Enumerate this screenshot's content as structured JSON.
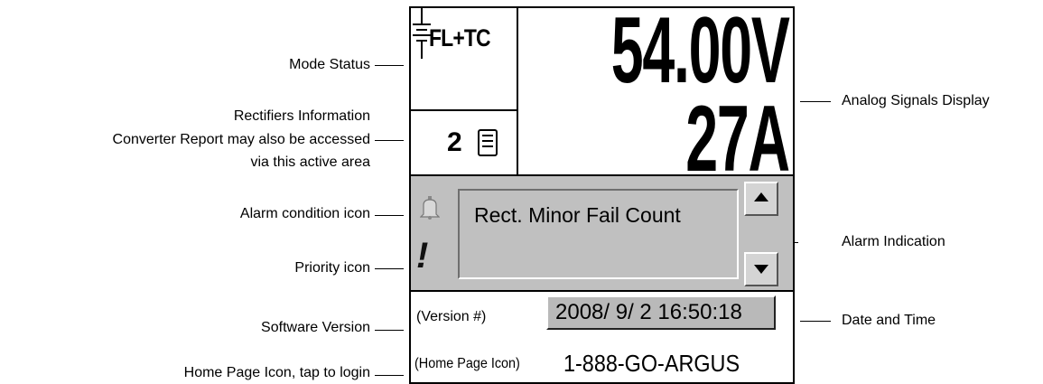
{
  "labels": {
    "mode_status": "Mode Status",
    "rectifiers_1": "Rectifiers Information",
    "rectifiers_2": "Converter Report may also be accessed",
    "rectifiers_3": "via this active area",
    "alarm_icon": "Alarm condition icon",
    "priority_icon": "Priority icon",
    "software_version": "Software Version",
    "home_page": "Home Page Icon, tap to login",
    "analog": "Analog Signals Display",
    "alarm_indication": "Alarm Indication",
    "date_time": "Date and Time"
  },
  "screen": {
    "mode_text": "FL+TC",
    "rectifier_count": "2",
    "voltage": "54.00V",
    "current": "27A",
    "alarm_text": "Rect. Minor Fail Count",
    "priority_glyph": "!",
    "version_text": "(Version #)",
    "datetime": "2008/ 9/ 2 16:50:18",
    "home_text": "(Home Page Icon)",
    "phone": "1-888-GO-ARGUS"
  },
  "icons": {
    "mode": "battery-symbol-icon",
    "rectifier": "report-document-icon",
    "alarm": "bell-icon",
    "scroll_up": "arrow-up-icon",
    "scroll_down": "arrow-down-icon"
  }
}
